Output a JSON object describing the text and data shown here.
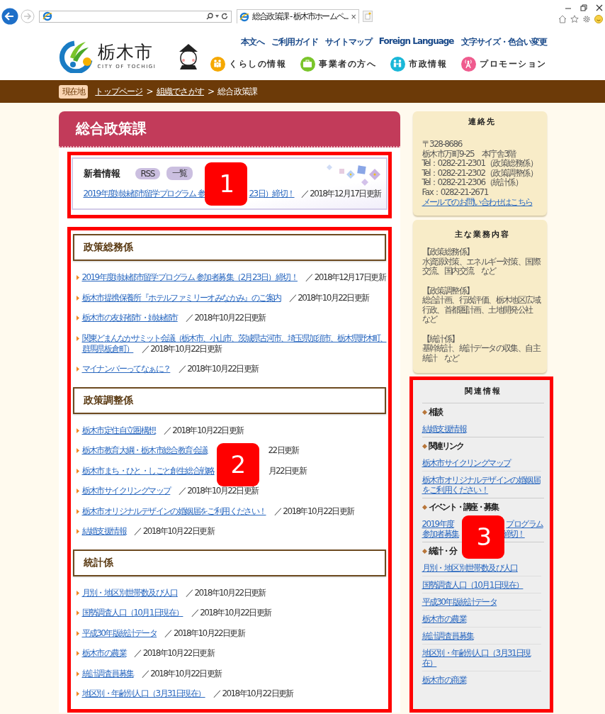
{
  "browser": {
    "tab_title": "総合政策課 - 栃木市ホームペ...",
    "tab_close": "×"
  },
  "header": {
    "logo_text": "栃木市",
    "logo_subtitle": "CITY OF TOCHIGI",
    "utility_links": [
      "本文へ",
      "ご利用ガイド",
      "サイトマップ",
      "Foreign Language",
      "文字サイズ・色合い変更"
    ],
    "nav": [
      {
        "label": "くらしの情報",
        "color": "#f5a800"
      },
      {
        "label": "事業者の方へ",
        "color": "#7ac52b"
      },
      {
        "label": "市政情報",
        "color": "#1ab7d8"
      },
      {
        "label": "プロモーション",
        "color": "#ef5b8e"
      }
    ]
  },
  "breadcrumb": {
    "label": "現在地",
    "items": [
      {
        "kind": "link",
        "text": "トップページ"
      },
      {
        "kind": "separator",
        "text": ">"
      },
      {
        "kind": "link",
        "text": "組織でさがす"
      },
      {
        "kind": "separator",
        "text": ">"
      },
      {
        "kind": "current",
        "text": "総合政策課"
      }
    ]
  },
  "page_title": "総合政策課",
  "news": {
    "title": "新着情報",
    "buttons": [
      "RSS",
      "一覧"
    ],
    "items": [
      {
        "kind": "covered",
        "parts": [
          "2019年度姉妹都市留学プログラム 参",
          "23日）締切！"
        ],
        "date": "／ 2018年12月17日更新"
      }
    ]
  },
  "sections": [
    {
      "title": "政策総務係",
      "items": [
        {
          "kind": "link",
          "link": "2019年度姉妹都市留学プログラム 参加者募集（2月23日）締切！",
          "date": "／ 2018年12月17日更新"
        },
        {
          "kind": "link",
          "link": "栃木市提携保養所『ホテルファミリーオみなかみ』のご案内",
          "date": "／ 2018年10月22日更新"
        },
        {
          "kind": "link",
          "link": "栃木市の友好都市・姉妹都市",
          "date": "／ 2018年10月22日更新"
        },
        {
          "kind": "wrapped",
          "link_lines": [
            "関東どまんなかサミット会議（栃木市、小山市、茨城県古河市、埼玉県加須市、栃木県野木町、",
            "群馬県板倉町）"
          ],
          "date": "／ 2018年10月22日更新"
        },
        {
          "kind": "link",
          "link": "マイナンバーってなぁに？",
          "date": "／ 2018年10月22日更新"
        }
      ]
    },
    {
      "title": "政策調整係",
      "items": [
        {
          "kind": "link",
          "link": "栃木市定住自立圏構想",
          "date": "／ 2018年10月22日更新"
        },
        {
          "kind": "covered",
          "link": "栃木市教育大綱・栃木市総合教育会議",
          "date": "22日更新"
        },
        {
          "kind": "covered",
          "link": "栃木市まち・ひと・しごと創生総合戦略",
          "date": "月22日更新"
        },
        {
          "kind": "link",
          "link": "栃木市サイクリングマップ",
          "date": "／ 2018年10月22日更新"
        },
        {
          "kind": "link",
          "link": "栃木市オリジナルデザインの婚姻届をご利用ください！",
          "date": "／ 2018年10月22日更新"
        },
        {
          "kind": "link",
          "link": "結婚支援情報",
          "date": "／ 2018年10月22日更新"
        }
      ]
    },
    {
      "title": "統計係",
      "items": [
        {
          "kind": "link",
          "link": "月別・地区別世帯数及び人口",
          "date": "／ 2018年10月22日更新"
        },
        {
          "kind": "link",
          "link": "国勢調査人口（10月1日現在）",
          "date": "／ 2018年10月22日更新"
        },
        {
          "kind": "link",
          "link": "平成30年版統計データ",
          "date": "／ 2018年10月22日更新"
        },
        {
          "kind": "link",
          "link": "栃木市の農業",
          "date": "／ 2018年10月22日更新"
        },
        {
          "kind": "link",
          "link": "統計調査員募集",
          "date": "／ 2018年10月22日更新"
        },
        {
          "kind": "link",
          "link": "地区別・年齢別人口（3月31日現在）",
          "date": "／ 2018年10月22日更新"
        }
      ]
    }
  ],
  "contact": {
    "title": "連絡先",
    "lines": [
      "〒328-8686",
      "栃木市万町9-25　本庁舎3階",
      "Tel：0282-21-2301（政策総務係）",
      "Tel：0282-21-2302（政策調整係）",
      "Tel：0282-21-2306（統計係）",
      "Fax：0282-21-2671"
    ],
    "mail_link": "メールでのお問い合わせはこちら"
  },
  "duties": {
    "title": "主な業務内容",
    "groups": [
      {
        "heading": "【政策総務係】",
        "lines": [
          "水資源対策、エネルギー対策、国際",
          "交流、国内交流　など"
        ]
      },
      {
        "heading": "【政策調整係】",
        "lines": [
          "総合計画、行政評価、栃木地区広域",
          "行政、首都圏計画、土地開発公社",
          "など"
        ]
      },
      {
        "heading": "【統計係】",
        "lines": [
          "基幹統計、統計データの収集、自主",
          "統計　など"
        ]
      }
    ]
  },
  "related": {
    "title": "関連情報",
    "groups": [
      {
        "heading": "相談",
        "links": [
          {
            "kind": "link",
            "text": "結婚支援情報"
          }
        ]
      },
      {
        "heading": "関連リンク",
        "links": [
          {
            "kind": "link",
            "text": "栃木市サイクリングマップ"
          },
          {
            "kind": "link",
            "text": "栃木市オリジナルデザインの婚姻届をご利用ください！"
          }
        ]
      },
      {
        "heading": "イベント・講座・募集",
        "links": [
          {
            "kind": "covered",
            "lines": [
              [
                "2019年度",
                "プログラム"
              ],
              [
                "参加者募集",
                "締切！"
              ]
            ]
          }
        ]
      },
      {
        "heading": "統計・分",
        "links": [
          {
            "kind": "link",
            "text": "月別・地区別世帯数及び人口"
          },
          {
            "kind": "link",
            "text": "国勢調査人口（10月1日現在）"
          },
          {
            "kind": "link",
            "text": "平成30年版統計データ"
          },
          {
            "kind": "link",
            "text": "栃木市の農業"
          },
          {
            "kind": "link",
            "text": "統計調査員募集"
          },
          {
            "kind": "link",
            "text": "地区別・年齢別人口（3月31日現在）"
          },
          {
            "kind": "link",
            "text": "栃木市の商業"
          }
        ]
      }
    ]
  },
  "annotations": [
    {
      "number": "1"
    },
    {
      "number": "2"
    },
    {
      "number": "3"
    }
  ]
}
